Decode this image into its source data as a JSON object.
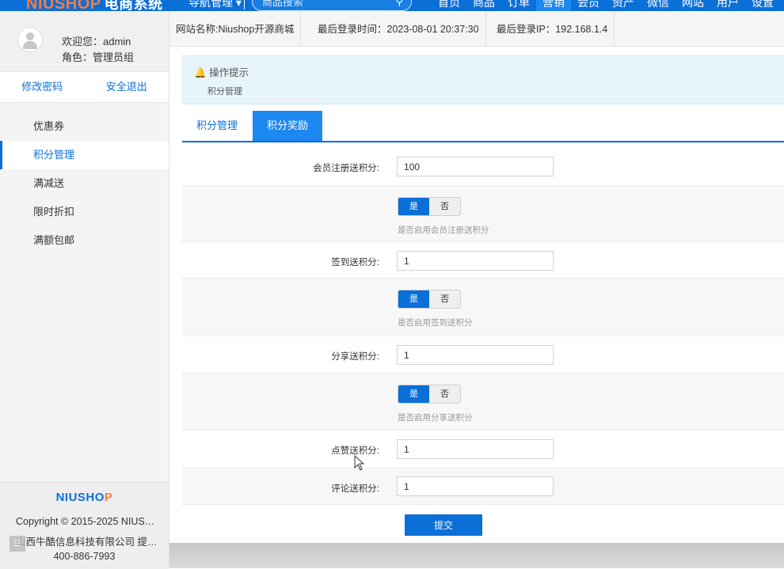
{
  "brand": {
    "logo_en": "NIUSHOP",
    "logo_cn": "电商系统"
  },
  "topnav": {
    "nav_manage": "导航管理 ▾",
    "search_placeholder": "商品搜索",
    "items": [
      "首页",
      "商品",
      "订单",
      "营销",
      "会员",
      "资产",
      "微信",
      "网站",
      "用户",
      "设置"
    ],
    "active_item": "营销"
  },
  "user": {
    "welcome": "欢迎您：admin",
    "role": "角色：管理员组",
    "change_password": "修改密码",
    "logout": "安全退出"
  },
  "sidebar": {
    "items": [
      {
        "label": "优惠券",
        "active": false
      },
      {
        "label": "积分管理",
        "active": true
      },
      {
        "label": "满减送",
        "active": false
      },
      {
        "label": "限时折扣",
        "active": false
      },
      {
        "label": "满额包邮",
        "active": false
      }
    ],
    "footer": {
      "logo": "NIUSHOP",
      "copyright": "Copyright © 2015-2025 NIUS…",
      "company": "山西牛酷信息科技有限公司 提…",
      "phone": "400-886-7993"
    }
  },
  "infobar": {
    "site_name": "网站名称:Niushop开源商城",
    "last_login_time": "最后登录时间：2023-08-01 20:37:30",
    "last_login_ip": "最后登录IP：192.168.1.4"
  },
  "tip": {
    "title": "操作提示",
    "body": "积分管理"
  },
  "tabs": [
    "积分管理",
    "积分奖励"
  ],
  "active_tab": "积分奖励",
  "form": {
    "register": {
      "label": "会员注册送积分:",
      "value": "100",
      "on": "是",
      "off": "否",
      "hint": "是否启用会员注册送积分"
    },
    "signin": {
      "label": "签到送积分:",
      "value": "1",
      "on": "是",
      "off": "否",
      "hint": "是否启用签到送积分"
    },
    "share": {
      "label": "分享送积分:",
      "value": "1",
      "on": "是",
      "off": "否",
      "hint": "是否启用分享送积分"
    },
    "like": {
      "label": "点赞送积分:",
      "value": "1"
    },
    "comment": {
      "label": "评论送积分:",
      "value": "1"
    },
    "submit": "提交"
  },
  "colors": {
    "primary": "#0b6fd8",
    "accent": "#ff7a3d",
    "tab_active": "#1d88f0",
    "tip_bg": "#e8f4fb"
  }
}
